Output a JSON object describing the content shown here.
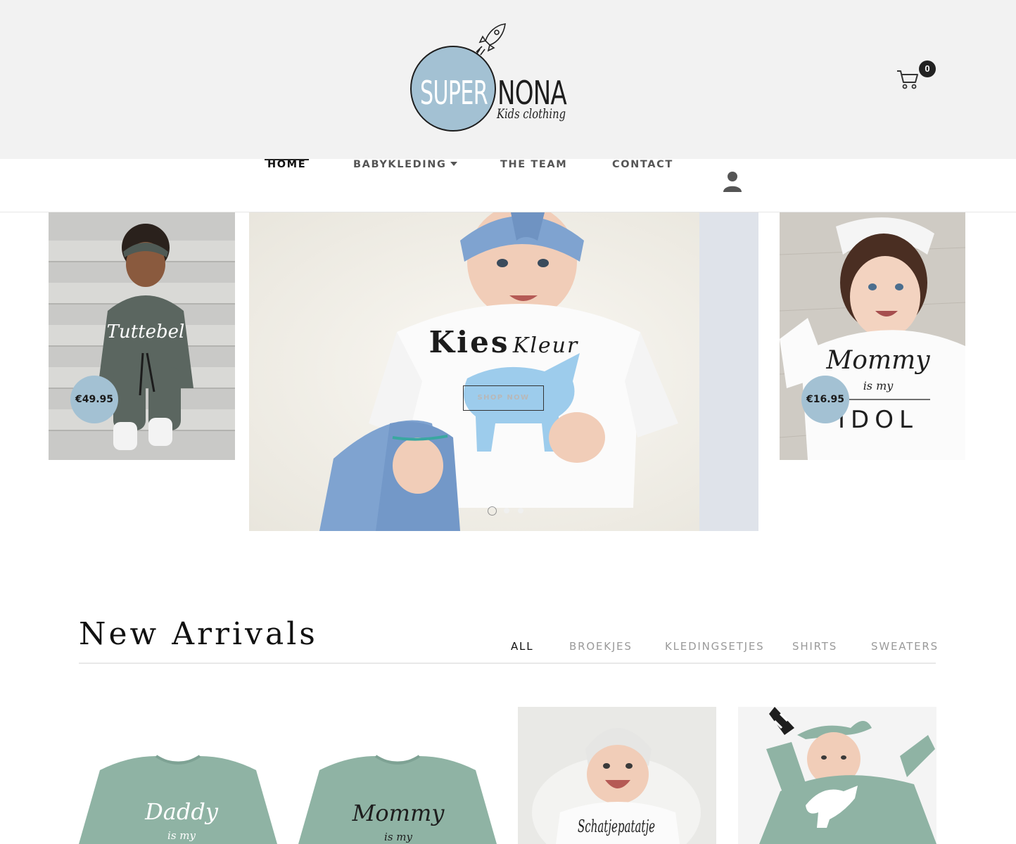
{
  "header": {
    "logo_main_left": "SUPER",
    "logo_main_right": "NONA",
    "logo_sub": "Kids clothing",
    "cart_count": "0",
    "cart_icon": "shopping-cart-icon"
  },
  "nav": {
    "items": [
      {
        "label": "HOME",
        "active": true
      },
      {
        "label": "BABYKLEDING",
        "has_dropdown": true
      },
      {
        "label": "THE TEAM"
      },
      {
        "label": "CONTACT"
      }
    ],
    "account_icon": "user-icon"
  },
  "hero": {
    "title_bold": "Kies",
    "title_italic": "Kleur",
    "button_label": "SHOP NOW",
    "slides": 3,
    "active_slide": 1
  },
  "side_cards": [
    {
      "price": "€49.95",
      "shirt_text": "Tuttebel"
    },
    {
      "price": "€16.95",
      "shirt_text_1": "Mommy",
      "shirt_text_2": "is my",
      "shirt_text_3": "IDOL"
    }
  ],
  "new_arrivals": {
    "title": "New Arrivals",
    "filters": [
      "ALL",
      "BROEKJES",
      "KLEDINGSETJES",
      "SHIRTS",
      "SWEATERS"
    ],
    "active_filter": "ALL",
    "products": [
      {
        "shirt_text_1": "Daddy",
        "shirt_text_2": "is my"
      },
      {
        "shirt_text_1": "Mommy",
        "shirt_text_2": "is my"
      },
      {
        "shirt_text_1": "Schatjepatatje"
      },
      {
        "shirt_text_1": ""
      }
    ]
  },
  "colors": {
    "header_bg": "#f2f2f2",
    "accent_blue": "#a3c1d3",
    "sage_green": "#8fb3a4",
    "denim": "#7fa3d0"
  }
}
